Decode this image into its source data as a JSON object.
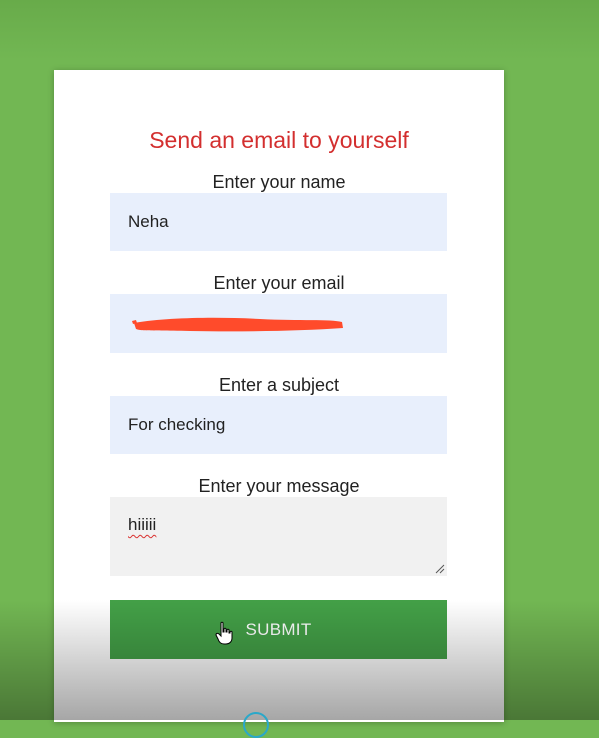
{
  "form": {
    "title": "Send an email to yourself",
    "name_label": "Enter your name",
    "name_value": "Neha",
    "email_label": "Enter your email",
    "email_value": "",
    "subject_label": "Enter a subject",
    "subject_value": "For checking",
    "message_label": "Enter your message",
    "message_value": "hiiiii",
    "submit_label": "SUBMIT"
  },
  "colors": {
    "background": "#72b753",
    "title": "#d32f2f",
    "input_bg": "#e8effc",
    "textarea_bg": "#f1f1f1",
    "button": "#43a047",
    "redaction": "#ff4b2b"
  },
  "icons": [
    "hand-pointer-cursor-icon",
    "resize-grip-icon"
  ]
}
